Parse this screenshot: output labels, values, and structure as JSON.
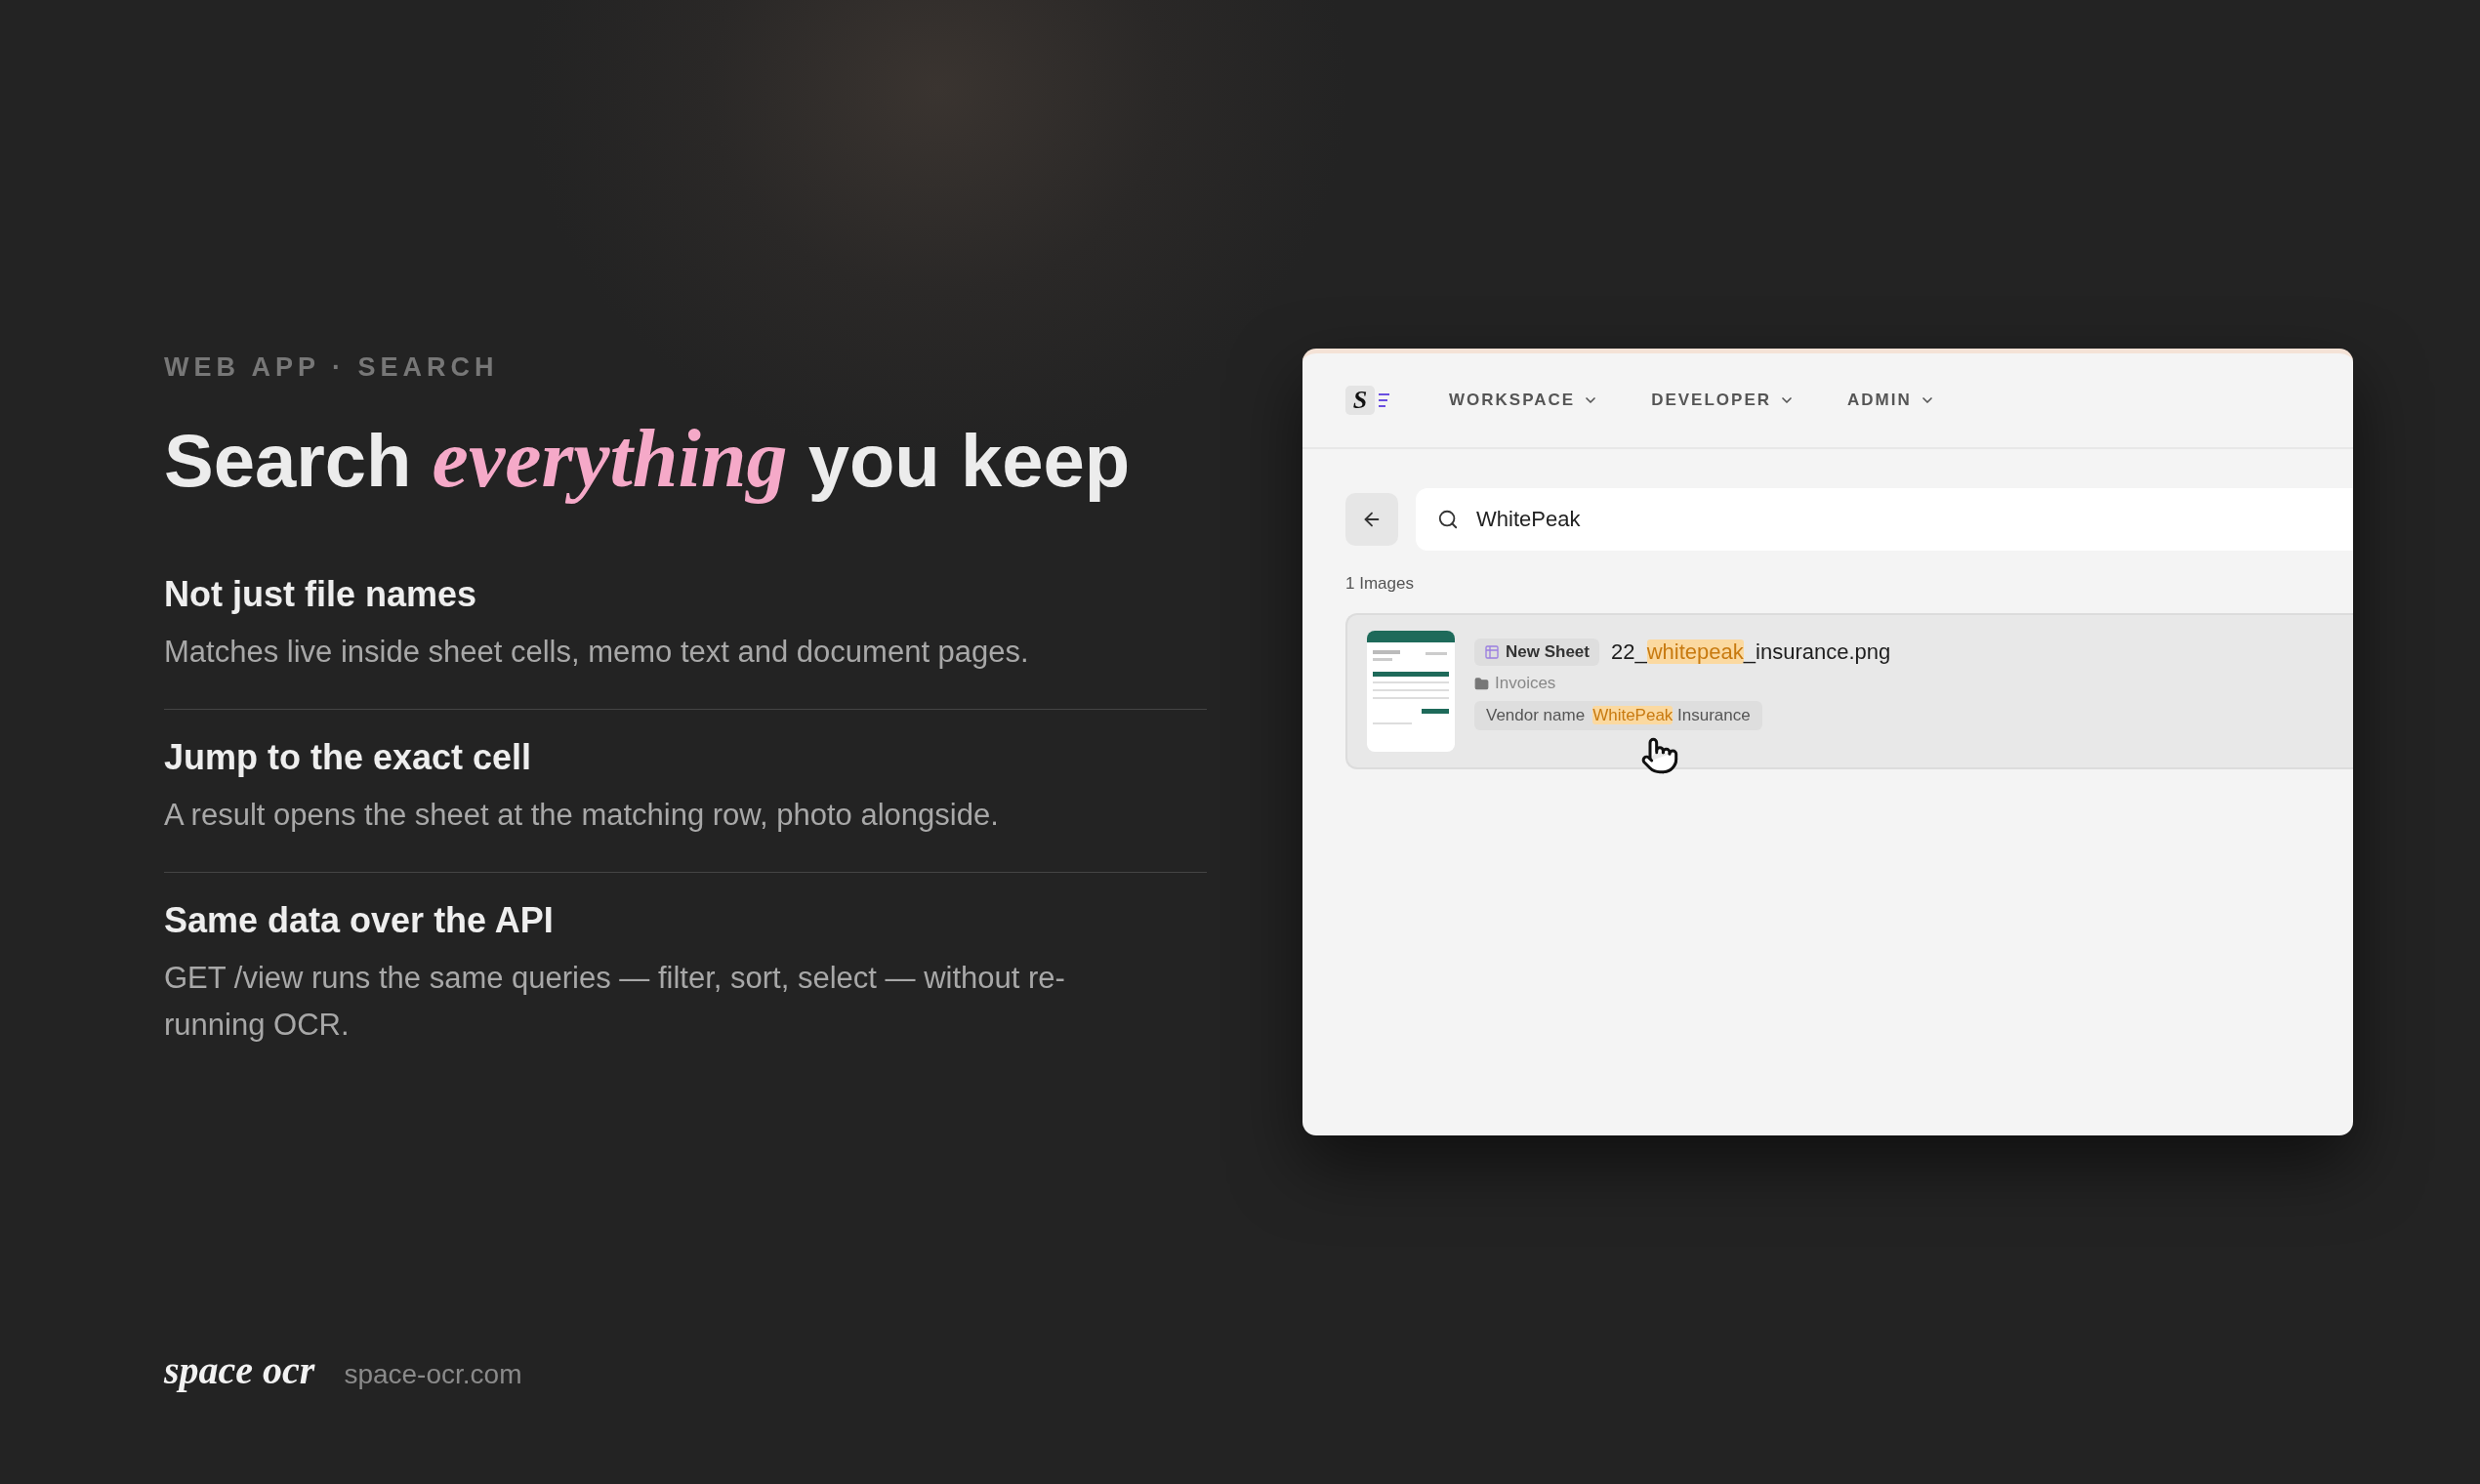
{
  "eyebrow": "WEB APP · SEARCH",
  "headline": "Search *everything* you keep",
  "features": [
    {
      "title": "Not just file names",
      "description": "Matches live inside sheet cells, memo text and document pages."
    },
    {
      "title": "Jump to the exact cell",
      "description": "A result opens the sheet at the matching row, photo alongside."
    },
    {
      "title": "Same data over the API",
      "description": "GET /view runs the same queries — filter, sort, select — without re-running OCR."
    }
  ],
  "footer": {
    "brand": "space ocr",
    "url": "space-ocr.com"
  },
  "app": {
    "logo": "S",
    "nav": [
      {
        "label": "WORKSPACE"
      },
      {
        "label": "DEVELOPER"
      },
      {
        "label": "ADMIN"
      }
    ],
    "search": {
      "value": "WhitePeak"
    },
    "result_count": "1 Images",
    "results": [
      {
        "chip": "New Sheet",
        "filename": [
          {
            "text": "22_",
            "highlighted": false
          },
          {
            "text": "whitepeak",
            "highlighted": true
          },
          {
            "text": "_insurance.png",
            "highlighted": false
          }
        ],
        "folder": "Invoices",
        "match_label": "Vendor name",
        "match": [
          {
            "text": "WhitePeak",
            "highlighted": true
          },
          {
            "text": "Insurance",
            "highlighted": false
          }
        ]
      }
    ]
  }
}
